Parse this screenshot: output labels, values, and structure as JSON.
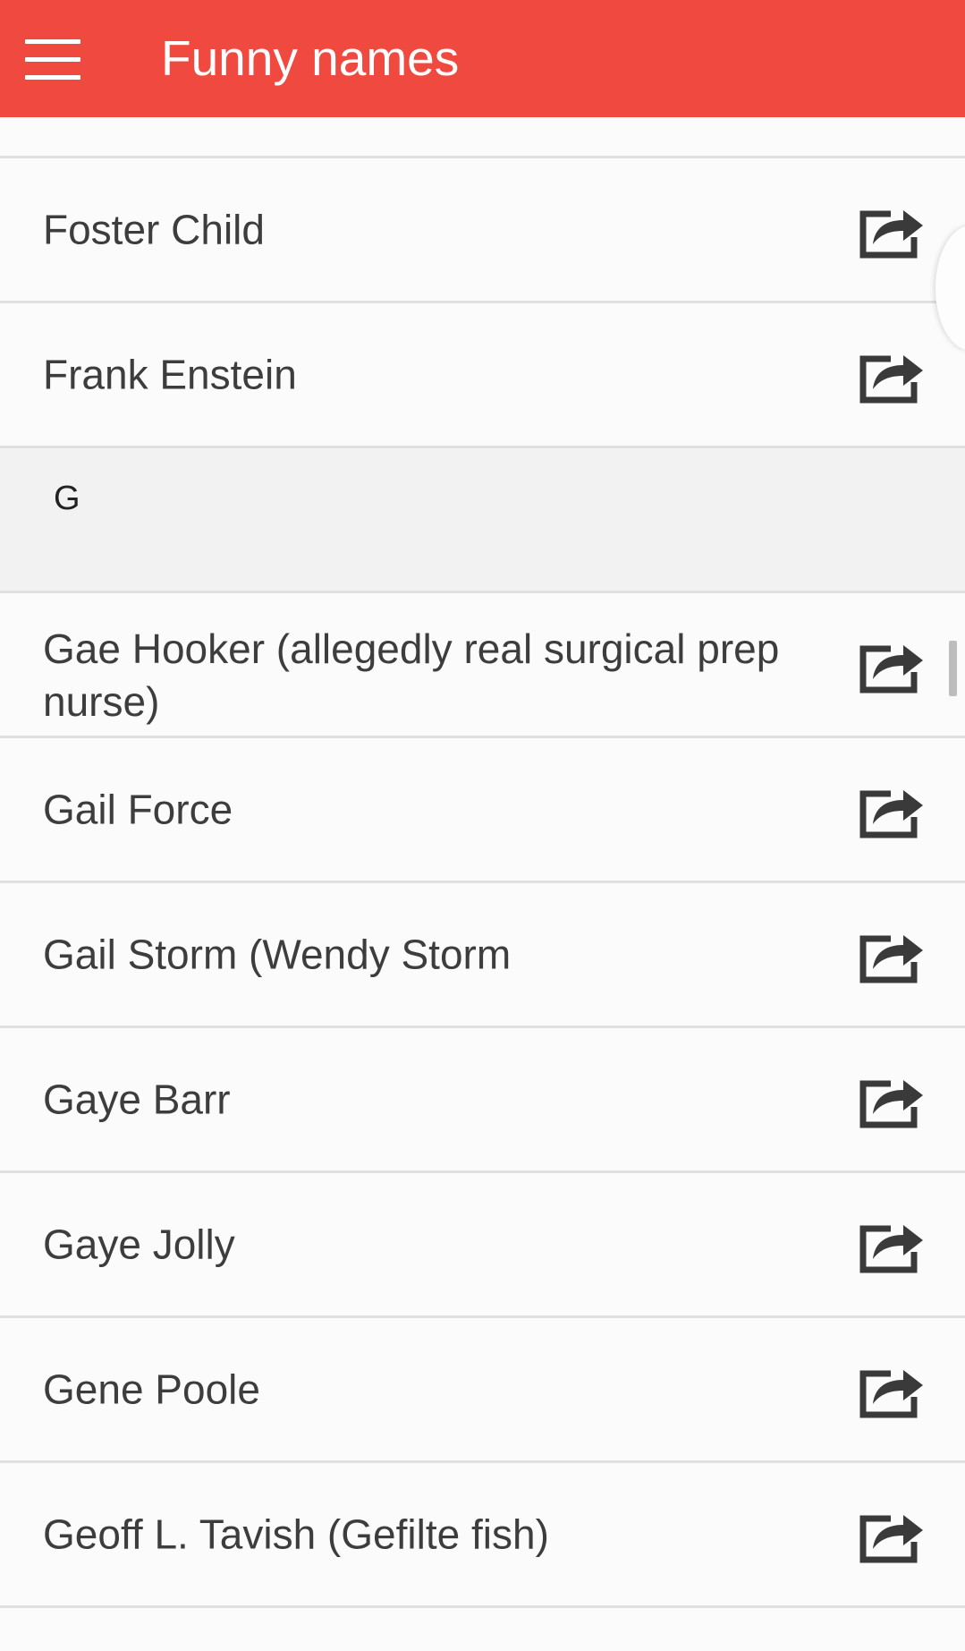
{
  "app": {
    "title": "Funny names",
    "accent_color": "#f04a40",
    "menu_icon": "hamburger-menu-icon",
    "share_icon": "share-arrow-icon"
  },
  "list": {
    "items_before": [
      {
        "label": "Foster Child"
      },
      {
        "label": "Frank Enstein"
      }
    ],
    "section_header": "G",
    "items_after": [
      {
        "label": "Gae Hooker (allegedly real surgical prep nurse)"
      },
      {
        "label": "Gail Force"
      },
      {
        "label": "Gail Storm (Wendy Storm"
      },
      {
        "label": "Gaye Barr"
      },
      {
        "label": "Gaye Jolly"
      },
      {
        "label": "Gene Poole"
      },
      {
        "label": "Geoff L. Tavish (Gefilte fish)"
      }
    ]
  }
}
